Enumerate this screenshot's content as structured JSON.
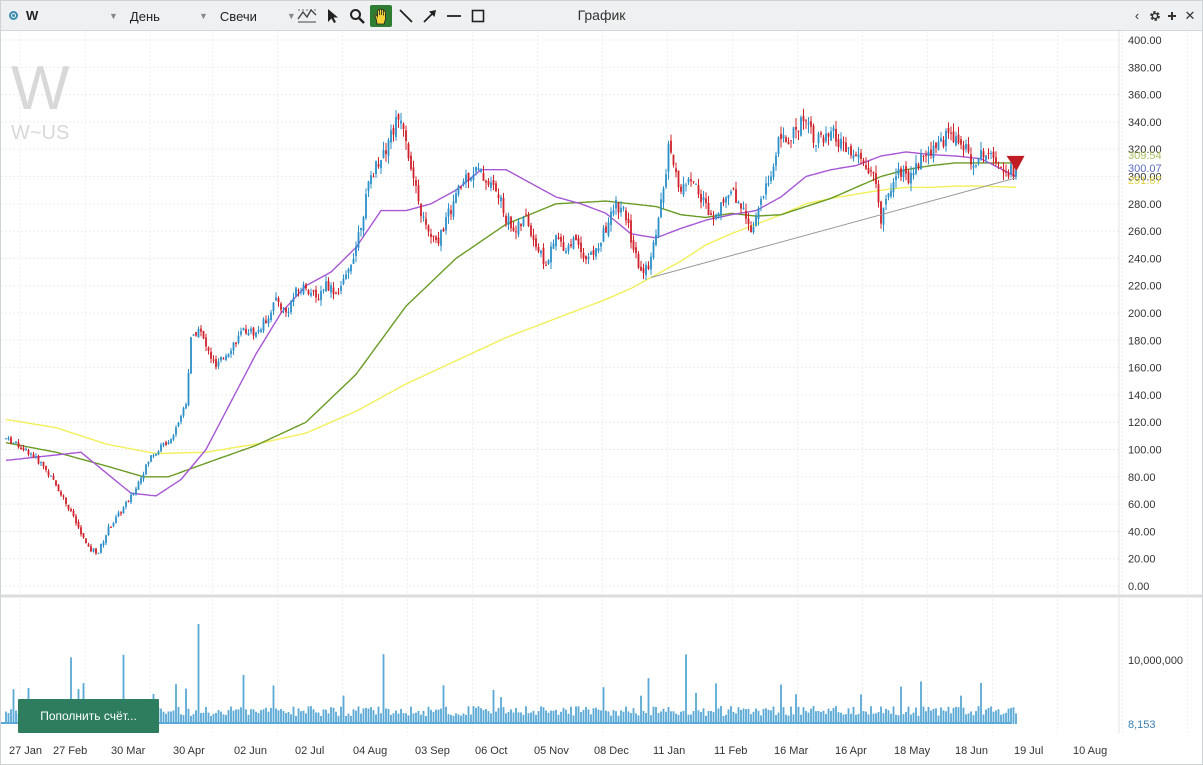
{
  "toolbar": {
    "symbol": "W",
    "period": "День",
    "chart_type": "Свечи",
    "title": "График",
    "tools": [
      "indicators-icon",
      "cursor-icon",
      "zoom-icon",
      "hand-icon",
      "line-icon",
      "arrow-icon",
      "horizontal-line-icon",
      "rectangle-icon"
    ],
    "active_tool": "hand-icon"
  },
  "watermark": {
    "big": "W",
    "small": "W~US"
  },
  "price_axis": {
    "labels": [
      "400.00",
      "380.00",
      "360.00",
      "340.00",
      "320.00",
      "300.00",
      "280.00",
      "260.00",
      "240.00",
      "220.00",
      "200.00",
      "180.00",
      "160.00",
      "140.00",
      "120.00",
      "100.00",
      "80.00",
      "60.00",
      "40.00",
      "20.00",
      "0.00"
    ],
    "current_labels": [
      {
        "text": "309.54",
        "color": "#a8c060"
      },
      {
        "text": "300.07",
        "color": "#5c6bc0"
      },
      {
        "text": "291.67",
        "color": "#e3d84a"
      }
    ]
  },
  "volume_axis": {
    "labels": [
      "10,000,000",
      "8,153"
    ]
  },
  "time_axis": {
    "labels": [
      "27 Jan",
      "27 Feb",
      "30 Mar",
      "30 Apr",
      "02 Jun",
      "02 Jul",
      "04 Aug",
      "03 Sep",
      "06 Oct",
      "05 Nov",
      "08 Dec",
      "11 Jan",
      "11 Feb",
      "16 Mar",
      "16 Apr",
      "18 May",
      "18 Jun",
      "19 Jul",
      "10 Aug"
    ]
  },
  "deposit_button": "Пополнить счёт...",
  "colors": {
    "up": "#2b8fc9",
    "down": "#d0202a",
    "ma_short": "#a757d6",
    "ma_mid": "#6a9b25",
    "ma_long": "#f2ef5a",
    "trend": "#999999",
    "volume": "#5aa9d6"
  },
  "chart_data": {
    "type": "candlestick",
    "ylim": [
      0,
      400
    ],
    "anchors": [
      [
        0,
        108
      ],
      [
        5,
        103
      ],
      [
        10,
        97
      ],
      [
        15,
        88
      ],
      [
        22,
        68
      ],
      [
        28,
        46
      ],
      [
        33,
        27
      ],
      [
        37,
        25
      ],
      [
        41,
        42
      ],
      [
        45,
        52
      ],
      [
        50,
        65
      ],
      [
        54,
        80
      ],
      [
        58,
        95
      ],
      [
        62,
        102
      ],
      [
        66,
        108
      ],
      [
        70,
        125
      ],
      [
        72,
        135
      ],
      [
        74,
        180
      ],
      [
        77,
        190
      ],
      [
        80,
        175
      ],
      [
        84,
        160
      ],
      [
        88,
        170
      ],
      [
        92,
        180
      ],
      [
        96,
        188
      ],
      [
        100,
        185
      ],
      [
        104,
        195
      ],
      [
        108,
        210
      ],
      [
        112,
        200
      ],
      [
        116,
        215
      ],
      [
        120,
        220
      ],
      [
        124,
        210
      ],
      [
        128,
        222
      ],
      [
        132,
        215
      ],
      [
        136,
        225
      ],
      [
        140,
        250
      ],
      [
        143,
        275
      ],
      [
        146,
        300
      ],
      [
        149,
        312
      ],
      [
        152,
        322
      ],
      [
        155,
        335
      ],
      [
        158,
        345
      ],
      [
        160,
        330
      ],
      [
        162,
        305
      ],
      [
        165,
        280
      ],
      [
        168,
        262
      ],
      [
        172,
        250
      ],
      [
        176,
        268
      ],
      [
        180,
        285
      ],
      [
        184,
        300
      ],
      [
        188,
        305
      ],
      [
        192,
        298
      ],
      [
        196,
        290
      ],
      [
        200,
        270
      ],
      [
        204,
        260
      ],
      [
        208,
        270
      ],
      [
        212,
        250
      ],
      [
        216,
        235
      ],
      [
        220,
        255
      ],
      [
        224,
        248
      ],
      [
        228,
        255
      ],
      [
        232,
        240
      ],
      [
        236,
        245
      ],
      [
        240,
        262
      ],
      [
        244,
        280
      ],
      [
        248,
        270
      ],
      [
        252,
        240
      ],
      [
        255,
        228
      ],
      [
        258,
        240
      ],
      [
        261,
        270
      ],
      [
        263,
        290
      ],
      [
        265,
        320
      ],
      [
        267,
        305
      ],
      [
        270,
        290
      ],
      [
        274,
        300
      ],
      [
        278,
        285
      ],
      [
        282,
        272
      ],
      [
        286,
        280
      ],
      [
        290,
        290
      ],
      [
        294,
        280
      ],
      [
        298,
        262
      ],
      [
        302,
        280
      ],
      [
        306,
        300
      ],
      [
        309,
        330
      ],
      [
        312,
        325
      ],
      [
        316,
        335
      ],
      [
        320,
        345
      ],
      [
        323,
        330
      ],
      [
        327,
        325
      ],
      [
        331,
        330
      ],
      [
        335,
        320
      ],
      [
        339,
        315
      ],
      [
        343,
        310
      ],
      [
        347,
        300
      ],
      [
        350,
        270
      ],
      [
        353,
        290
      ],
      [
        357,
        305
      ],
      [
        361,
        300
      ],
      [
        365,
        310
      ],
      [
        369,
        318
      ],
      [
        373,
        325
      ],
      [
        377,
        330
      ],
      [
        381,
        328
      ],
      [
        385,
        315
      ],
      [
        389,
        312
      ],
      [
        393,
        322
      ],
      [
        397,
        312
      ],
      [
        401,
        305
      ],
      [
        404,
        305
      ]
    ],
    "ma_short": [
      [
        0,
        92
      ],
      [
        30,
        98
      ],
      [
        50,
        68
      ],
      [
        60,
        66
      ],
      [
        70,
        78
      ],
      [
        80,
        100
      ],
      [
        90,
        135
      ],
      [
        100,
        170
      ],
      [
        110,
        200
      ],
      [
        120,
        220
      ],
      [
        130,
        230
      ],
      [
        140,
        248
      ],
      [
        150,
        275
      ],
      [
        160,
        275
      ],
      [
        170,
        280
      ],
      [
        180,
        290
      ],
      [
        190,
        305
      ],
      [
        200,
        305
      ],
      [
        210,
        295
      ],
      [
        220,
        285
      ],
      [
        230,
        280
      ],
      [
        240,
        273
      ],
      [
        250,
        258
      ],
      [
        260,
        255
      ],
      [
        270,
        262
      ],
      [
        280,
        268
      ],
      [
        290,
        272
      ],
      [
        300,
        275
      ],
      [
        310,
        285
      ],
      [
        320,
        300
      ],
      [
        330,
        305
      ],
      [
        340,
        308
      ],
      [
        350,
        315
      ],
      [
        360,
        318
      ],
      [
        370,
        316
      ],
      [
        380,
        315
      ],
      [
        390,
        313
      ],
      [
        404,
        300
      ]
    ],
    "ma_mid": [
      [
        0,
        105
      ],
      [
        20,
        98
      ],
      [
        40,
        88
      ],
      [
        55,
        80
      ],
      [
        65,
        80
      ],
      [
        80,
        90
      ],
      [
        100,
        103
      ],
      [
        120,
        120
      ],
      [
        140,
        155
      ],
      [
        160,
        205
      ],
      [
        180,
        240
      ],
      [
        200,
        265
      ],
      [
        220,
        280
      ],
      [
        240,
        282
      ],
      [
        260,
        278
      ],
      [
        270,
        272
      ],
      [
        280,
        270
      ],
      [
        290,
        273
      ],
      [
        300,
        271
      ],
      [
        310,
        272
      ],
      [
        320,
        278
      ],
      [
        330,
        284
      ],
      [
        340,
        292
      ],
      [
        350,
        300
      ],
      [
        360,
        305
      ],
      [
        370,
        308
      ],
      [
        380,
        310
      ],
      [
        390,
        310
      ],
      [
        404,
        310
      ]
    ],
    "ma_long": [
      [
        0,
        122
      ],
      [
        20,
        116
      ],
      [
        40,
        104
      ],
      [
        60,
        97
      ],
      [
        80,
        98
      ],
      [
        100,
        104
      ],
      [
        120,
        112
      ],
      [
        140,
        128
      ],
      [
        160,
        148
      ],
      [
        180,
        165
      ],
      [
        200,
        182
      ],
      [
        220,
        196
      ],
      [
        240,
        210
      ],
      [
        250,
        218
      ],
      [
        260,
        228
      ],
      [
        270,
        238
      ],
      [
        280,
        250
      ],
      [
        290,
        258
      ],
      [
        300,
        265
      ],
      [
        310,
        272
      ],
      [
        320,
        280
      ],
      [
        330,
        284
      ],
      [
        340,
        287
      ],
      [
        350,
        290
      ],
      [
        360,
        292
      ],
      [
        370,
        292
      ],
      [
        380,
        293
      ],
      [
        390,
        293
      ],
      [
        404,
        292
      ]
    ],
    "trendline": [
      [
        258,
        226
      ],
      [
        404,
        299
      ]
    ],
    "signal_arrow": {
      "index": 405,
      "price": 310
    }
  }
}
